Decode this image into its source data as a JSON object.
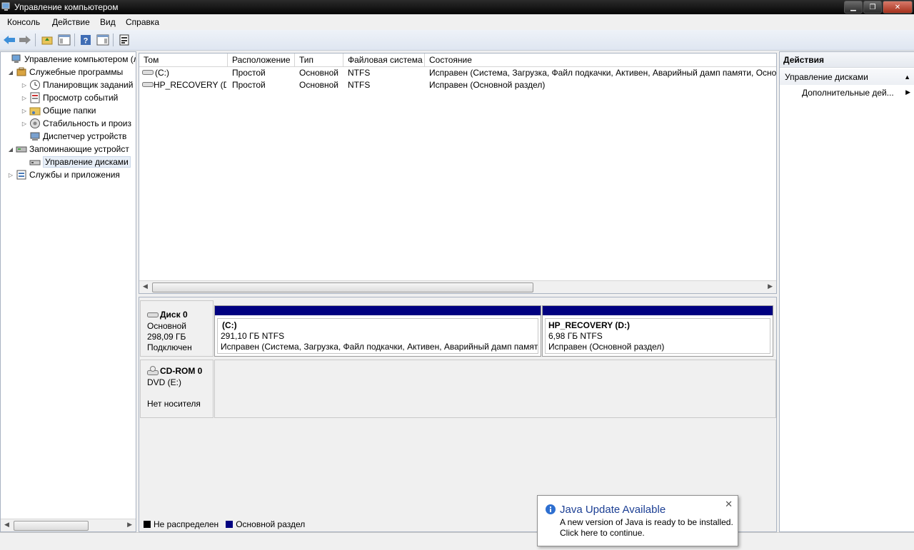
{
  "window": {
    "title": "Управление компьютером"
  },
  "menu": [
    "Консоль",
    "Действие",
    "Вид",
    "Справка"
  ],
  "tree": {
    "items": [
      {
        "label": "Управление компьютером (л",
        "level": 0
      },
      {
        "label": "Служебные программы",
        "level": 1
      },
      {
        "label": "Планировщик заданий",
        "level": 2
      },
      {
        "label": "Просмотр событий",
        "level": 2
      },
      {
        "label": "Общие папки",
        "level": 2
      },
      {
        "label": "Стабильность и произ",
        "level": 2
      },
      {
        "label": "Диспетчер устройств",
        "level": 2
      },
      {
        "label": "Запоминающие устройст",
        "level": 1
      },
      {
        "label": "Управление дисками",
        "level": 2
      },
      {
        "label": "Службы и приложения",
        "level": 1
      }
    ]
  },
  "volumes": {
    "columns": [
      "Том",
      "Расположение",
      "Тип",
      "Файловая система",
      "Состояние"
    ],
    "rows": [
      [
        "(C:)",
        "Простой",
        "Основной",
        "NTFS",
        "Исправен (Система, Загрузка, Файл подкачки, Активен, Аварийный дамп памяти, Осно"
      ],
      [
        "HP_RECOVERY (D:)",
        "Простой",
        "Основной",
        "NTFS",
        "Исправен (Основной раздел)"
      ]
    ]
  },
  "disks": {
    "disk0": {
      "name": "Диск 0",
      "type": "Основной",
      "size": "298,09 ГБ",
      "status": "Подключен",
      "partitions": [
        {
          "name": "(C:)",
          "size": "291,10 ГБ NTFS",
          "status": "Исправен (Система, Загрузка, Файл подкачки, Активен, Аварийный дамп памяти"
        },
        {
          "name": "HP_RECOVERY  (D:)",
          "size": "6,98 ГБ NTFS",
          "status": "Исправен (Основной раздел)"
        }
      ]
    },
    "cdrom0": {
      "name": "CD-ROM 0",
      "drive": "DVD (E:)",
      "status": "Нет носителя"
    }
  },
  "legend": [
    {
      "label": "Не распределен",
      "color": "#000000"
    },
    {
      "label": "Основной раздел",
      "color": "#000080"
    }
  ],
  "actions": {
    "header": "Действия",
    "section": "Управление дисками",
    "more": "Дополнительные дей..."
  },
  "notification": {
    "title": "Java Update Available",
    "line1": "A new version of Java is ready to be installed.",
    "line2": "Click here to continue."
  },
  "colors": {
    "partition_bar": "#000080",
    "title_blue": "#1c3f94"
  }
}
